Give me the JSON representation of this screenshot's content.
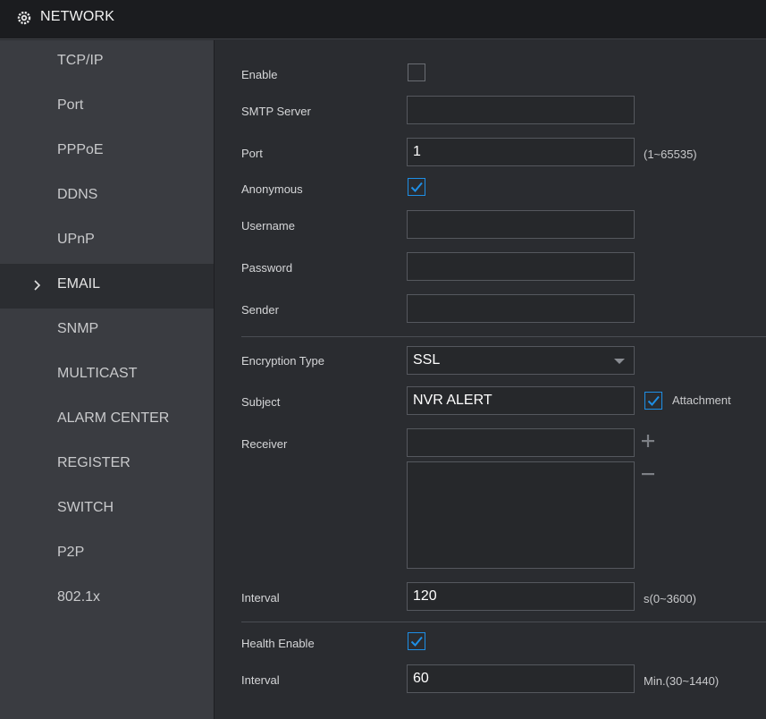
{
  "app": {
    "title": "NETWORK",
    "logo_icon": "network-gear-icon"
  },
  "colors": {
    "accent": "#1e8fe6",
    "titlebar_bg": "#1b1c1f",
    "sidebar_bg": "#3a3c41",
    "content_bg": "#2a2c30"
  },
  "sidebar": {
    "active_index": 5,
    "items": [
      {
        "label": "TCP/IP"
      },
      {
        "label": "Port"
      },
      {
        "label": "PPPoE"
      },
      {
        "label": "DDNS"
      },
      {
        "label": "UPnP"
      },
      {
        "label": "EMAIL"
      },
      {
        "label": "SNMP"
      },
      {
        "label": "MULTICAST"
      },
      {
        "label": "ALARM CENTER"
      },
      {
        "label": "REGISTER"
      },
      {
        "label": "SWITCH"
      },
      {
        "label": "P2P"
      },
      {
        "label": "802.1x"
      }
    ]
  },
  "form": {
    "enable": {
      "label": "Enable",
      "checked": false
    },
    "smtp_server": {
      "label": "SMTP Server",
      "value": ""
    },
    "port": {
      "label": "Port",
      "value": "1",
      "hint": "(1~65535)"
    },
    "anonymous": {
      "label": "Anonymous",
      "checked": true
    },
    "username": {
      "label": "Username",
      "value": ""
    },
    "password": {
      "label": "Password",
      "value": ""
    },
    "sender": {
      "label": "Sender",
      "value": ""
    },
    "encryption_type": {
      "label": "Encryption Type",
      "value": "SSL"
    },
    "subject": {
      "label": "Subject",
      "value": "NVR ALERT"
    },
    "attachment": {
      "label": "Attachment",
      "checked": true
    },
    "receiver": {
      "label": "Receiver",
      "value": "",
      "list": []
    },
    "interval": {
      "label": "Interval",
      "value": "120",
      "hint": "s(0~3600)"
    },
    "health_enable": {
      "label": "Health Enable",
      "checked": true
    },
    "health_interval": {
      "label": "Interval",
      "value": "60",
      "hint": "Min.(30~1440)"
    }
  }
}
